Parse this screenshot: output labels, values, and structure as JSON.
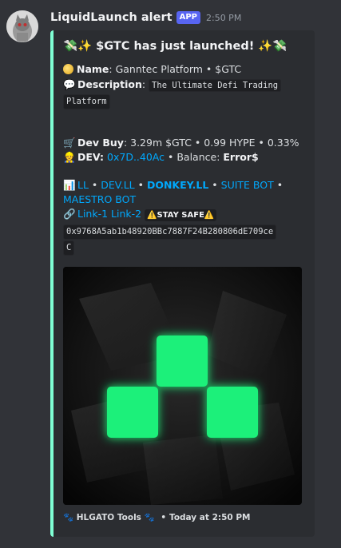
{
  "message": {
    "author": "LiquidLaunch alert",
    "badge": "APP",
    "timestamp": "2:50 PM"
  },
  "embed": {
    "accent_color": "#7fffd4",
    "title": "💸✨ $GTC has just launched! ✨💸",
    "name_label": "Name",
    "name_value": ": Ganntec Platform • $GTC",
    "description_label": "Description",
    "description_value_line1": "The Ultimate Defi Trading",
    "description_value_line2": "Platform",
    "dev_buy_label": "Dev Buy",
    "dev_buy_value": ": 3.29m $GTC • 0.99 HYPE • 0.33%",
    "dev_label": "DEV:",
    "dev_address": "0x7D..40Ac",
    "balance_label": " • Balance: ",
    "balance_value": "Error$",
    "links_row1": {
      "ll": "LL",
      "dev_ll": "DEV.LL",
      "donkey": "DONKEY.LL",
      "suite": "SUITE BOT",
      "sep": " • "
    },
    "links_row2": {
      "maestro": "MAESTRO BOT"
    },
    "links_row3": {
      "link1": "Link-1",
      "link2": "Link-2",
      "stay_safe": "STAY SAFE"
    },
    "contract_line1": "0x9768A5ab1b48920BBc7887F24B280806dE709ce",
    "contract_line2": "C",
    "footer_text": "HLGATO Tools",
    "footer_time": "Today at 2:50 PM"
  },
  "icons": {
    "money": "money-with-wings-icon",
    "sparkles": "sparkles-icon",
    "coin": "coin-icon",
    "speech": "speech-balloon-icon",
    "cart": "shopping-cart-icon",
    "worker": "construction-worker-icon",
    "chart": "bar-chart-icon",
    "link": "link-icon",
    "warning": "warning-icon",
    "paw": "paw-prints-icon"
  },
  "colors": {
    "link": "#00a8fc",
    "badge": "#5865f2",
    "logo_green": "#22ff7a"
  }
}
